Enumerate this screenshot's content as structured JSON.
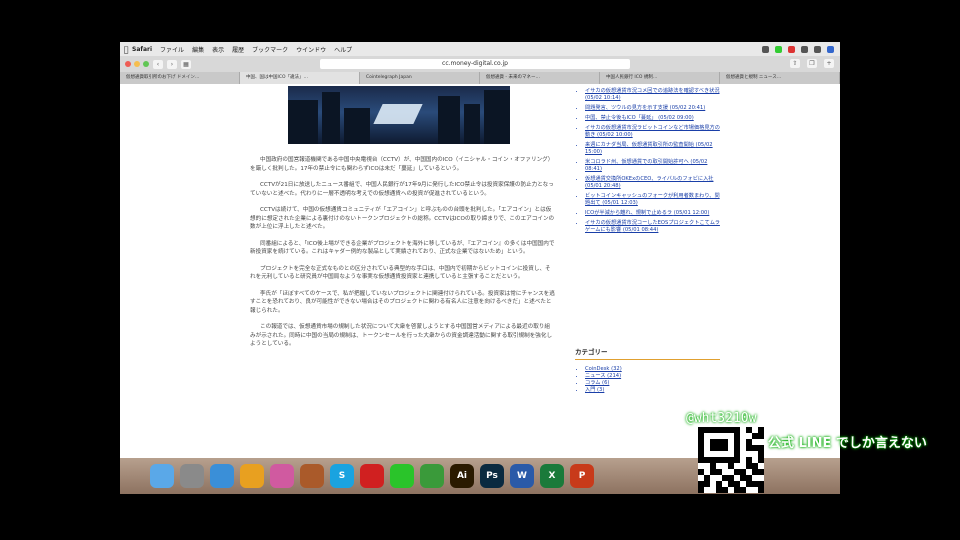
{
  "menubar": {
    "app": "Safari",
    "items": [
      "ファイル",
      "編集",
      "表示",
      "履歴",
      "ブックマーク",
      "ウインドウ",
      "ヘルプ"
    ]
  },
  "toolbar": {
    "url": "cc.money-digital.co.jp"
  },
  "tabs": [
    "仮想通貨取引所のお下げ ドメイン…",
    "中国、国は中国ICO「違法」…",
    "Cointelegraph Japan",
    "仮想通貨 - 未来のマネー…",
    "中国人民銀行 ICO 規制…",
    "仮想通貨と規制 ニュース…"
  ],
  "article": {
    "paragraphs": [
      "中国政府の国営報道機関である中国中央電視台（CCTV）が、中国国内のICO（イニシャル・コイン・オファリング）を厳しく批判した。17年の禁止令にも関わらずICOは未だ「蔓延」しているという。",
      "CCTVが21日に放送したニュース番組で、中国人民銀行が17年9月に発行したICO禁止令は投資家保護の防止力となっていないと述べた。代わりに一層不透明な考えでの仮想通貨への投資が促進されているという。",
      "CCTVは続けて、中国の仮想通貨コミュニティが「エアコイン」と呼ぶものの台頭を批判した。「エアコイン」とは仮想的に想定された企業による裏付けのないトークンプロジェクトの総称。CCTVはICOの取り締まりで、このエアコインの数が上位に浮上したと述べた。",
      "同番組によると、「ICO後上場ができる企業がプロジェクトを海外に移しているが、『エアコイン』の多くは中国国内で新投資家を続けている。これはキャダー例的な製品として実績されており、正式な企業ではないため」という。",
      "プロジェクトを完全な正式なものとの区分されている典型的な手口は、中国内で初期からビットコインに投資し、それを元利していると研究員が中国局なような事実な仮想通貨投資家と連携していると主張することだという。",
      "李氏が「ほぼすべてのケースで、私が把握していないプロジェクトに関連付けられている。投資家は常にチャンスを逃すことを恐れており、良が可能性ができない場合はそのプロジェクトに関わる有名人に注意を向けるべきだ」と述べたと報じられた。",
      "この報道では、仮想通貨市場の規制した状況について大衆を啓蒙しようとする中国国営メディアによる最近の取り組みが示された。同時に中国の当局の規制は、トークンセールを行った大衆からの資金調達活動に関する取引規制を強化しようとしている。"
    ]
  },
  "sidebar": {
    "recent": [
      {
        "title": "イサカの仮想通貨市況コメ回での追跡法を確認すべき状況",
        "date": "(05/02 10:14)"
      },
      {
        "title": "問題発言、ツウルの見方を示す支援",
        "date": "(05/02 20:41)"
      },
      {
        "title": "中国、禁止令後もICO「蔓延」",
        "date": "(05/02 09:00)"
      },
      {
        "title": "イサカの仮想通貨市況ラビットコインなど市場価格見方の動き",
        "date": "(05/02 10:00)"
      },
      {
        "title": "来週にカナダ当局、仮想通貨取引所の監査開始",
        "date": "(05/02 15:00)"
      },
      {
        "title": "米コロラド州、仮想通貨での取引開始許可へ",
        "date": "(05/02 08:41)"
      },
      {
        "title": "仮想通貨交換所OKExのCEO、ライバルのフォビに入社",
        "date": "(05/01 20:48)"
      },
      {
        "title": "ビットコインキャッシュのフォークが利用者数まわり、問題出て",
        "date": "(05/01 12:03)"
      },
      {
        "title": "ICOが半減から離れ、規制で止めるラ",
        "date": "(05/01 12:00)"
      },
      {
        "title": "イサカの仮想通貨市況コーしたEOSプロジェクトこてムラゲームにも影響",
        "date": "(05/01 08:44)"
      }
    ],
    "category_heading": "カテゴリー",
    "categories": [
      "CoinDesk (32)",
      "ニュース (214)",
      "コラム (6)",
      "入門 (3)"
    ]
  },
  "overlay": {
    "handle": "@wht3210w",
    "line_text": "公式 LINE でしか言えない"
  },
  "dock": {
    "apps": [
      {
        "name": "finder",
        "label": "",
        "color": "#5aa8e8"
      },
      {
        "name": "launchpad",
        "label": "",
        "color": "#8a8a8a"
      },
      {
        "name": "safari",
        "label": "",
        "color": "#3a8fd8"
      },
      {
        "name": "chrome",
        "label": "",
        "color": "#e8a020"
      },
      {
        "name": "photos",
        "label": "",
        "color": "#d05aa0"
      },
      {
        "name": "books",
        "label": "",
        "color": "#aa5a2a"
      },
      {
        "name": "skype",
        "label": "S",
        "color": "#1aa3e0"
      },
      {
        "name": "app-red",
        "label": "",
        "color": "#d02020"
      },
      {
        "name": "line",
        "label": "",
        "color": "#2ac42a"
      },
      {
        "name": "evernote",
        "label": "",
        "color": "#3a9a3a"
      },
      {
        "name": "illustrator",
        "label": "Ai",
        "color": "#2a1a00"
      },
      {
        "name": "photoshop",
        "label": "Ps",
        "color": "#0a2a40"
      },
      {
        "name": "word",
        "label": "W",
        "color": "#2a5aa8"
      },
      {
        "name": "excel",
        "label": "X",
        "color": "#1a7a3a"
      },
      {
        "name": "powerpoint",
        "label": "P",
        "color": "#c83a1a"
      }
    ]
  }
}
